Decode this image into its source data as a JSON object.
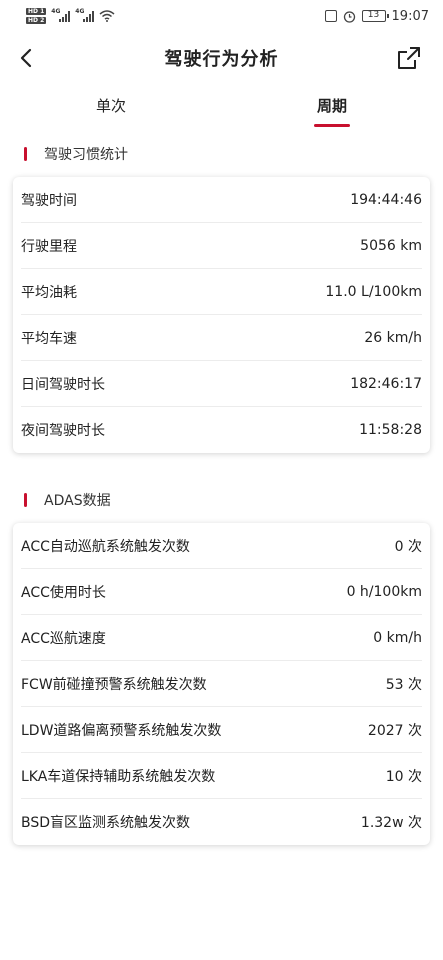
{
  "status_bar": {
    "sim1": "HD 1",
    "sim2": "HD 2",
    "network1": "4G",
    "network2": "4G",
    "battery": "13",
    "time": "19:07"
  },
  "header": {
    "title": "驾驶行为分析"
  },
  "tabs": [
    {
      "label": "单次"
    },
    {
      "label": "周期"
    }
  ],
  "habits": {
    "title": "驾驶习惯统计",
    "rows": [
      {
        "label": "驾驶时间",
        "value": "194:44:46"
      },
      {
        "label": "行驶里程",
        "value": "5056 km"
      },
      {
        "label": "平均油耗",
        "value": "11.0 L/100km"
      },
      {
        "label": "平均车速",
        "value": "26 km/h"
      },
      {
        "label": "日间驾驶时长",
        "value": "182:46:17"
      },
      {
        "label": "夜间驾驶时长",
        "value": "11:58:28"
      }
    ]
  },
  "adas": {
    "title": "ADAS数据",
    "rows": [
      {
        "label": "ACC自动巡航系统触发次数",
        "value": "0 次"
      },
      {
        "label": "ACC使用时长",
        "value": "0 h/100km"
      },
      {
        "label": "ACC巡航速度",
        "value": "0 km/h"
      },
      {
        "label": "FCW前碰撞预警系统触发次数",
        "value": "53 次"
      },
      {
        "label": "LDW道路偏离预警系统触发次数",
        "value": "2027 次"
      },
      {
        "label": "LKA车道保持辅助系统触发次数",
        "value": "10 次"
      },
      {
        "label": "BSD盲区监测系统触发次数",
        "value": "1.32w 次"
      }
    ]
  },
  "colors": {
    "accent": "#c8102e"
  }
}
